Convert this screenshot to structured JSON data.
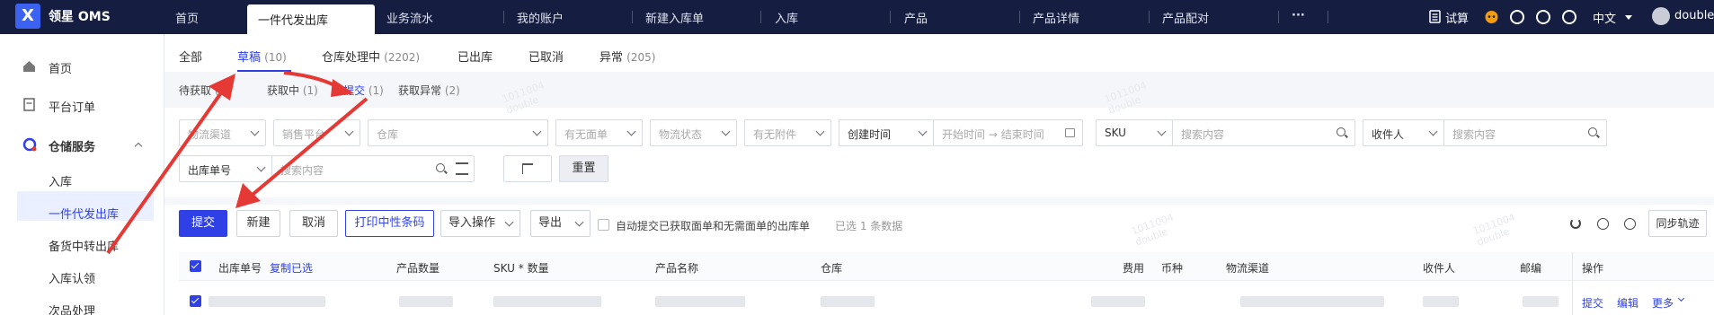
{
  "app": {
    "logo": "X",
    "name": "领星 OMS"
  },
  "topnav": {
    "items": [
      {
        "label": "首页"
      },
      {
        "label": "一件代发出库"
      },
      {
        "label": "业务流水"
      },
      {
        "label": "我的账户"
      },
      {
        "label": "新建入库单"
      },
      {
        "label": "入库"
      },
      {
        "label": "产品"
      },
      {
        "label": "产品详情"
      },
      {
        "label": "产品配对"
      }
    ],
    "more": "···"
  },
  "topright": {
    "trial": "试算",
    "lang": "中文",
    "user": "double"
  },
  "sidebar": {
    "items": [
      {
        "label": "首页"
      },
      {
        "label": "平台订单"
      },
      {
        "label": "仓储服务"
      }
    ],
    "sub": [
      {
        "label": "入库"
      },
      {
        "label": "一件代发出库"
      },
      {
        "label": "备货中转出库"
      },
      {
        "label": "入库认领"
      },
      {
        "label": "次品处理"
      }
    ]
  },
  "tabs": [
    {
      "label": "全部",
      "count": ""
    },
    {
      "label": "草稿",
      "count": "(10)"
    },
    {
      "label": "仓库处理中",
      "count": "(2202)"
    },
    {
      "label": "已出库",
      "count": ""
    },
    {
      "label": "已取消",
      "count": ""
    },
    {
      "label": "异常",
      "count": "(205)"
    }
  ],
  "subtabs": [
    {
      "label": "待获取",
      "count": "(6)"
    },
    {
      "label": "获取中",
      "count": "(1)"
    },
    {
      "label": "待提交",
      "count": "(1)"
    },
    {
      "label": "获取异常",
      "count": "(2)"
    }
  ],
  "filters": {
    "channel": "物流渠道",
    "platform": "销售平台",
    "warehouse": "仓库",
    "waybill": "有无面单",
    "logistics_status": "物流状态",
    "attachment": "有无附件",
    "time_type": "创建时间",
    "start": "开始时间",
    "arrow": "→",
    "end": "结束时间",
    "sku_type": "SKU",
    "sku_ph": "搜索内容",
    "receiver_type": "收件人",
    "receiver_ph": "搜索内容",
    "order_type": "出库单号",
    "order_ph": "搜索内容",
    "reset": "重置"
  },
  "toolbar": {
    "submit": "提交",
    "new": "新建",
    "cancel": "取消",
    "print": "打印中性条码",
    "import": "导入操作",
    "export": "导出",
    "auto_label": "自动提交已获取面单和无需面单的出库单",
    "selected": "已选 1 条数据",
    "sync": "同步轨迹"
  },
  "table": {
    "headers": {
      "order": "出库单号",
      "copy": "复制已选",
      "qty": "产品数量",
      "sku_qty": "SKU * 数量",
      "name": "产品名称",
      "warehouse": "仓库",
      "fee": "费用",
      "currency": "币种",
      "channel": "物流渠道",
      "receiver": "收件人",
      "postcode": "邮编",
      "ops": "操作"
    },
    "row_actions": {
      "submit": "提交",
      "edit": "编辑",
      "more": "更多"
    }
  },
  "watermark": {
    "line1": "1011004",
    "line2": "double"
  },
  "colors": {
    "topbar": "#151d40",
    "primary": "#2f40e6",
    "annotation": "#e53935"
  }
}
